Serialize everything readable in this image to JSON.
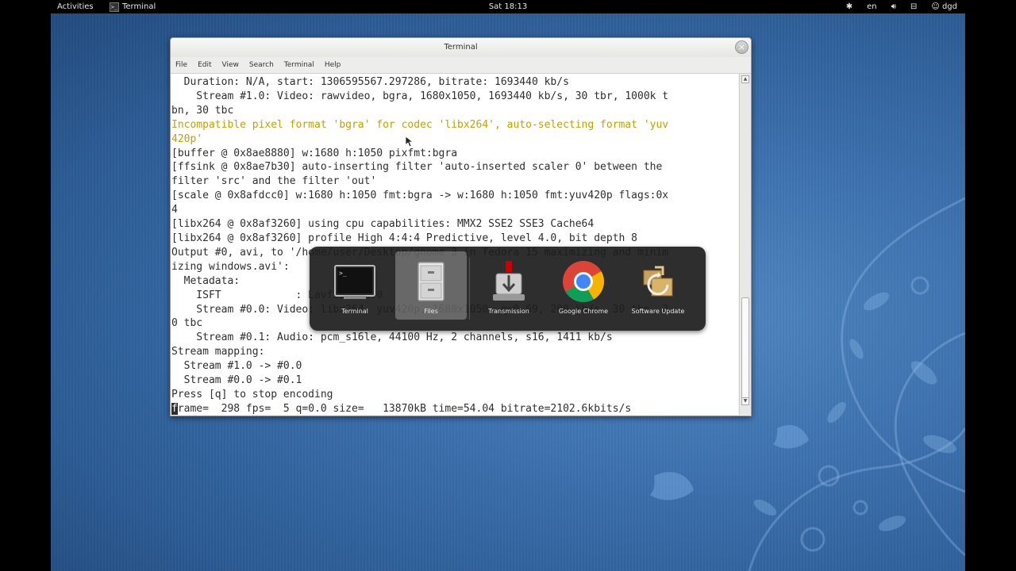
{
  "topbar": {
    "activities": "Activities",
    "app_name": "Terminal",
    "clock": "Sat 18:13",
    "language": "en",
    "user": "dgd"
  },
  "window": {
    "title": "Terminal",
    "close_glyph": "×",
    "menu": [
      "File",
      "Edit",
      "View",
      "Search",
      "Terminal",
      "Help"
    ]
  },
  "terminal": {
    "lines": [
      {
        "text": "  Duration: N/A, start: 1306595567.297286, bitrate: 1693440 kb/s",
        "style": "normal"
      },
      {
        "text": "    Stream #1.0: Video: rawvideo, bgra, 1680x1050, 1693440 kb/s, 30 tbr, 1000k t",
        "style": "normal"
      },
      {
        "text": "bn, 30 tbc",
        "style": "normal"
      },
      {
        "text": "Incompatible pixel format 'bgra' for codec 'libx264', auto-selecting format 'yuv",
        "style": "warn"
      },
      {
        "text": "420p'",
        "style": "warn"
      },
      {
        "text": "[buffer @ 0x8ae8880] w:1680 h:1050 pixfmt:bgra",
        "style": "normal"
      },
      {
        "text": "[ffsink @ 0x8ae7b30] auto-inserting filter 'auto-inserted scaler 0' between the",
        "style": "normal"
      },
      {
        "text": "filter 'src' and the filter 'out'",
        "style": "normal"
      },
      {
        "text": "[scale @ 0x8afdcc0] w:1680 h:1050 fmt:bgra -> w:1680 h:1050 fmt:yuv420p flags:0x",
        "style": "normal"
      },
      {
        "text": "4",
        "style": "normal"
      },
      {
        "text": "[libx264 @ 0x8af3260] using cpu capabilities: MMX2 SSE2 SSE3 Cache64",
        "style": "normal"
      },
      {
        "text": "[libx264 @ 0x8af3260] profile High 4:4:4 Predictive, level 4.0, bit depth 8",
        "style": "normal"
      },
      {
        "text": "Output #0, avi, to '/home/user/Desktop/gnome 3 in fedora 15 maximizing and minim",
        "style": "normal"
      },
      {
        "text": "izing windows.avi':",
        "style": "normal"
      },
      {
        "text": "  Metadata:",
        "style": "normal"
      },
      {
        "text": "    ISFT            : Lavf53.104.0",
        "style": "normal"
      },
      {
        "text": "    Stream #0.0: Video: libx264, yuv420p, 1680x1050, q=0-69, 200 kb/s, 30 tbn, 3",
        "style": "normal"
      },
      {
        "text": "0 tbc",
        "style": "normal"
      },
      {
        "text": "    Stream #0.1: Audio: pcm_s16le, 44100 Hz, 2 channels, s16, 1411 kb/s",
        "style": "normal"
      },
      {
        "text": "Stream mapping:",
        "style": "normal"
      },
      {
        "text": "  Stream #1.0 -> #0.0",
        "style": "normal"
      },
      {
        "text": "  Stream #0.0 -> #0.1",
        "style": "normal"
      },
      {
        "text": "Press [q] to stop encoding",
        "style": "normal"
      }
    ],
    "last_line_cursor_char": "f",
    "last_line_rest": "rame=  298 fps=  5 q=0.0 size=   13870kB time=54.04 bitrate=2102.6kbits/s"
  },
  "switcher": {
    "items": [
      {
        "label": "Terminal",
        "icon": "terminal-icon",
        "selected": false
      },
      {
        "label": "Files",
        "icon": "file-cabinet-icon",
        "selected": true
      },
      {
        "label": "Transmission",
        "icon": "transmission-icon",
        "selected": false
      },
      {
        "label": "Google Chrome",
        "icon": "chrome-icon",
        "selected": false
      },
      {
        "label": "Software Update",
        "icon": "software-update-icon",
        "selected": false
      }
    ]
  },
  "colors": {
    "desktop": "#3a6eab",
    "warning_text": "#c4a000",
    "switcher_bg": "#1c1c1c"
  }
}
